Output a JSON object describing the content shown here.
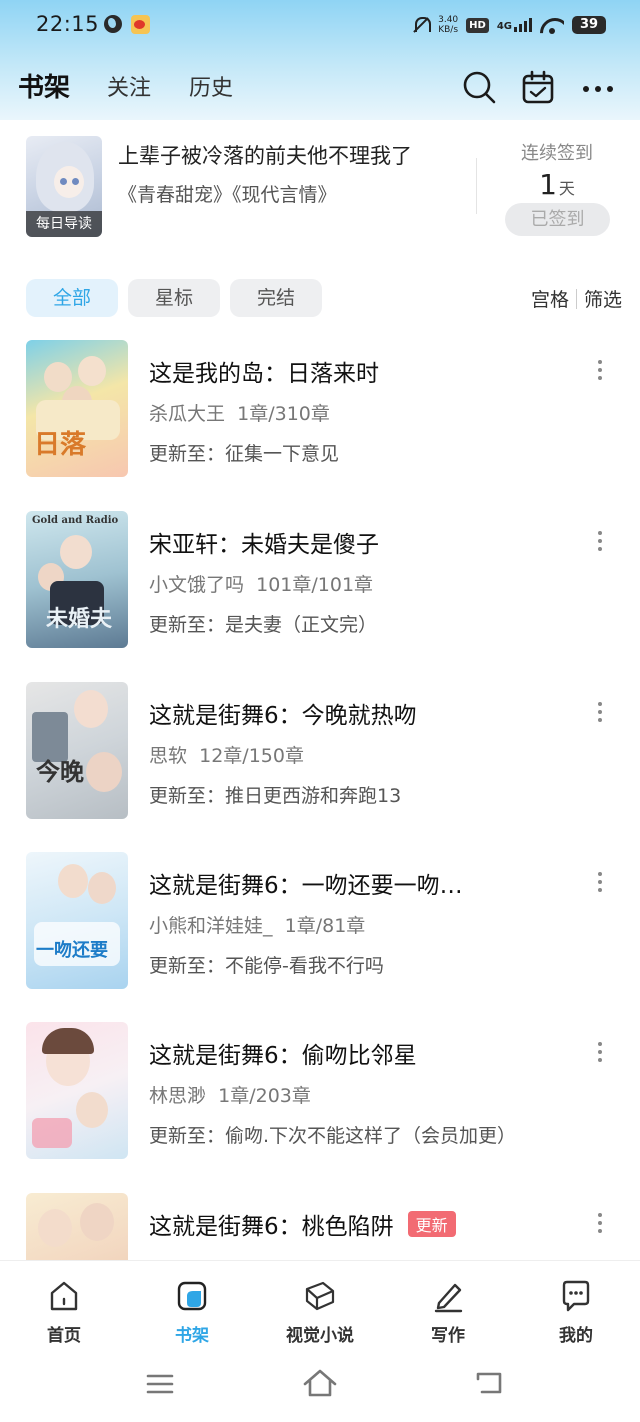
{
  "status_bar": {
    "time": "22:15",
    "net_speed_value": "3.40",
    "net_speed_unit": "KB/s",
    "hd": "HD",
    "signal": "4G",
    "battery": "39"
  },
  "header": {
    "tabs": [
      {
        "label": "书架",
        "active": true
      },
      {
        "label": "关注",
        "active": false
      },
      {
        "label": "历史",
        "active": false
      }
    ],
    "icons": [
      "search-icon",
      "calendar-check-icon",
      "more-horizontal-icon"
    ]
  },
  "daily": {
    "tag": "每日导读",
    "title": "上辈子被冷落的前夫他不理我了",
    "tags": "《青春甜宠》《现代言情》",
    "checkin_label": "连续签到",
    "checkin_days": "1",
    "checkin_unit": "天",
    "checkin_button": "已签到"
  },
  "filters": {
    "chips": [
      {
        "label": "全部",
        "active": true
      },
      {
        "label": "星标",
        "active": false
      },
      {
        "label": "完结",
        "active": false
      }
    ],
    "view_grid": "宫格",
    "view_filter": "筛选"
  },
  "books": [
    {
      "title": "这是我的岛：日落来时",
      "author": "杀瓜大王",
      "progress": "1章/310章",
      "update": "更新至：征集一下意见",
      "badge": ""
    },
    {
      "title": "宋亚轩：未婚夫是傻子",
      "author": "小文饿了吗",
      "progress": "101章/101章",
      "update": "更新至：是夫妻（正文完）",
      "badge": ""
    },
    {
      "title": "这就是街舞6：今晚就热吻",
      "author": "思软",
      "progress": "12章/150章",
      "update": "更新至：推日更西游和奔跑13",
      "badge": ""
    },
    {
      "title": "这就是街舞6：一吻还要一吻…",
      "author": "小熊和洋娃娃_",
      "progress": "1章/81章",
      "update": "更新至：不能停-看我不行吗",
      "badge": ""
    },
    {
      "title": "这就是街舞6：偷吻比邻星",
      "author": "林思渺",
      "progress": "1章/203章",
      "update": "更新至：偷吻.下次不能这样了（会员加更）",
      "badge": ""
    },
    {
      "title": "这就是街舞6：桃色陷阱",
      "author": "",
      "progress": "",
      "update": "",
      "badge": "更新"
    }
  ],
  "bottom_nav": [
    {
      "label": "首页",
      "icon": "home-icon",
      "active": false
    },
    {
      "label": "书架",
      "icon": "bookshelf-icon",
      "active": true
    },
    {
      "label": "视觉小说",
      "icon": "book-icon",
      "active": false
    },
    {
      "label": "写作",
      "icon": "pen-icon",
      "active": false
    },
    {
      "label": "我的",
      "icon": "chat-bubble-icon",
      "active": false
    }
  ],
  "colors": {
    "accent": "#2fa6e6",
    "badge": "#f26b73",
    "header_gradient_top": "#8fd4f4"
  }
}
